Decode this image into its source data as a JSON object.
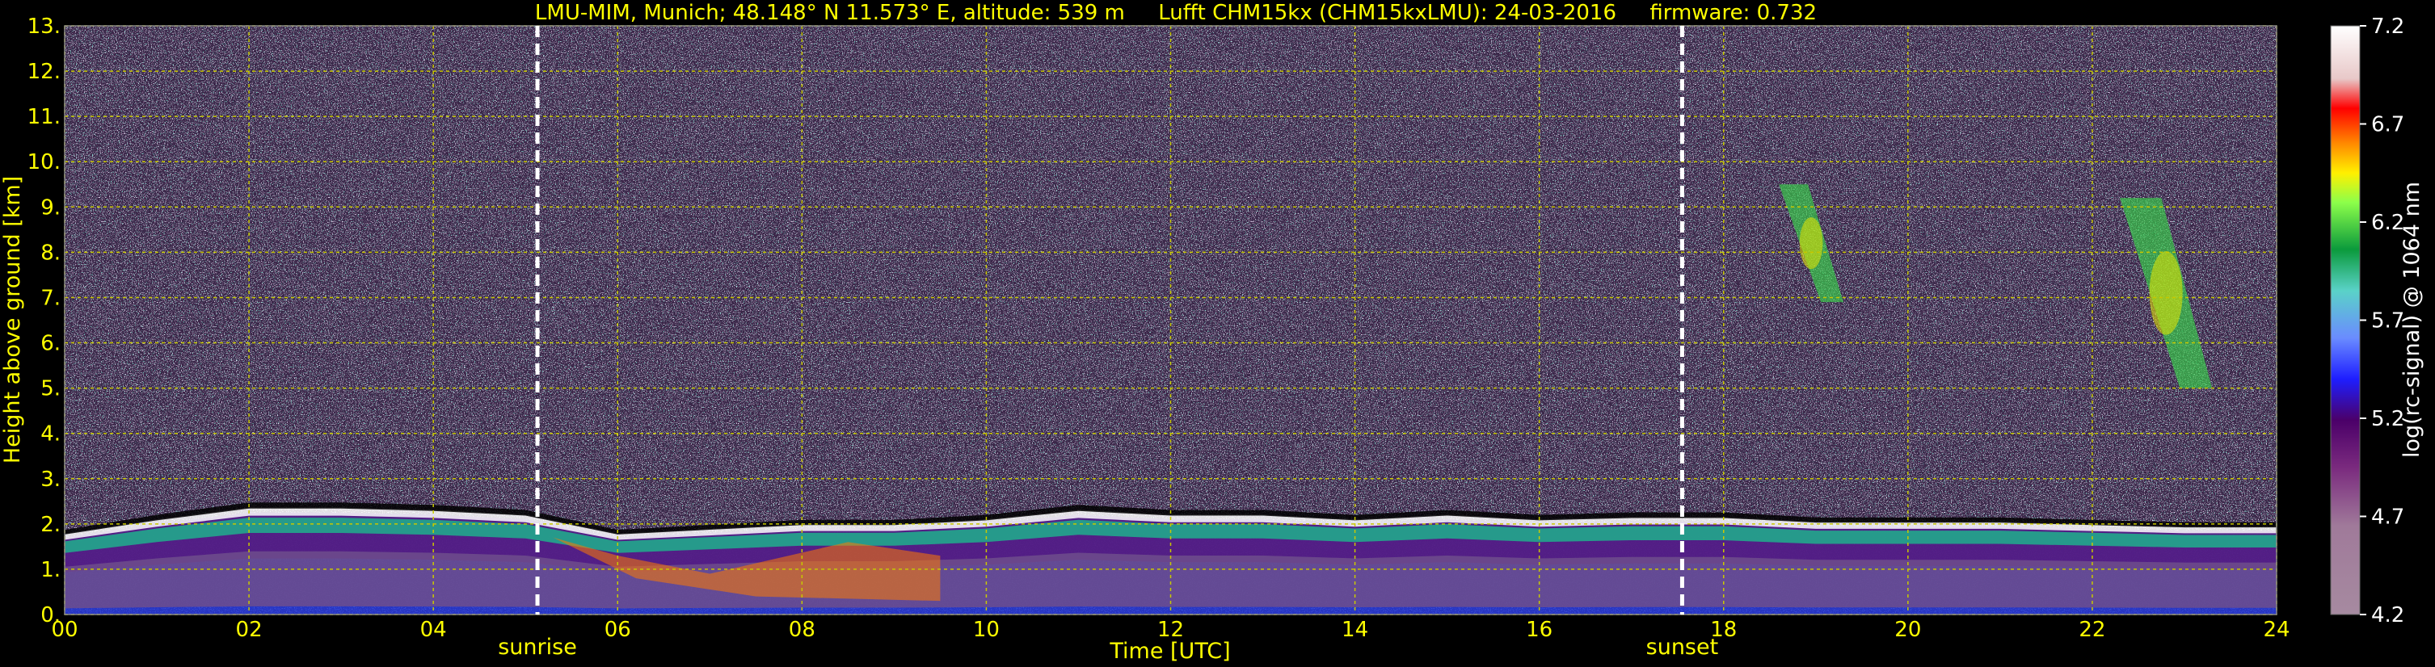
{
  "chart_data": {
    "type": "heatmap",
    "title": "LMU-MIM, Munich; 48.148° N 11.573° E, altitude: 539 m     Lufft CHM15kx (CHM15kxLMU): 24-03-2016     firmware: 0.732",
    "xlabel": "Time [UTC]",
    "ylabel": "Height above ground [km]",
    "xlim": [
      0,
      24
    ],
    "ylim": [
      0,
      13
    ],
    "x_ticks": [
      "00",
      "02",
      "04",
      "06",
      "08",
      "10",
      "12",
      "14",
      "16",
      "18",
      "20",
      "22",
      "24"
    ],
    "y_ticks": [
      "0.",
      "1.",
      "2.",
      "3.",
      "4.",
      "5.",
      "6.",
      "7.",
      "8.",
      "9.",
      "10.",
      "11.",
      "12.",
      "13."
    ],
    "grid": true,
    "colorbar": {
      "label": "log(rc-signal) @ 1064 nm",
      "range": [
        4.2,
        7.2
      ],
      "ticks": [
        "4.2",
        "4.7",
        "5.2",
        "5.7",
        "6.2",
        "6.7",
        "7.2"
      ]
    },
    "events": [
      {
        "name": "sunrise",
        "x": 5.13
      },
      {
        "name": "sunset",
        "x": 17.55
      }
    ],
    "features": [
      {
        "name": "boundary-layer top",
        "x": [
          0,
          1,
          2,
          3,
          4,
          5,
          6,
          7,
          8,
          9,
          10,
          11,
          12,
          13,
          14,
          15,
          16,
          17,
          18,
          19,
          20,
          21,
          22,
          23,
          24
        ],
        "y": [
          1.7,
          2.0,
          2.25,
          2.25,
          2.2,
          2.1,
          1.7,
          1.8,
          1.9,
          1.9,
          2.0,
          2.2,
          2.1,
          2.1,
          2.0,
          2.1,
          2.0,
          2.05,
          2.05,
          1.95,
          1.95,
          1.95,
          1.9,
          1.85,
          1.85
        ]
      },
      {
        "name": "cirrus 1",
        "x": [
          18.6,
          19.3
        ],
        "y": [
          6.9,
          9.5
        ]
      },
      {
        "name": "cirrus 2",
        "x": [
          22.3,
          23.3
        ],
        "y": [
          5.0,
          9.2
        ]
      }
    ],
    "colors": {
      "background": "#000000",
      "text": "#ffff00",
      "grid": "#c8c800",
      "event_line": "#ffffff"
    }
  }
}
